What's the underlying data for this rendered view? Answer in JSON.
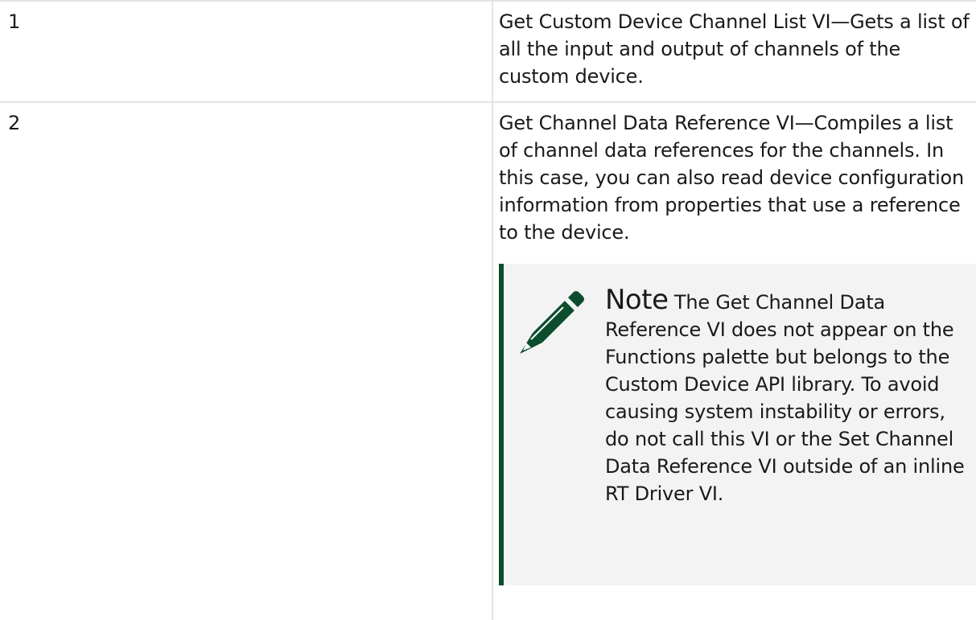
{
  "rows": [
    {
      "number": "1",
      "description": "Get Custom Device Channel List VI—Gets a list of all the input and output of channels of the custom device."
    },
    {
      "number": "2",
      "description": "Get Channel Data Reference VI—Compiles a list of channel data references for the channels. In this case, you can also read device configuration information from properties that use a reference to the device.",
      "note": {
        "label": "Note",
        "icon": "pencil-icon",
        "text": "The Get Channel Data Reference VI does not appear on the Functions palette but belongs to the Custom Device API library. To avoid causing system instability or errors, do not call this VI or the Set Channel Data Reference VI outside of an inline RT Driver VI."
      }
    }
  ],
  "colors": {
    "note_accent": "#0b4d2c",
    "note_background": "#f3f3f3",
    "table_border": "#e4e4e4"
  }
}
